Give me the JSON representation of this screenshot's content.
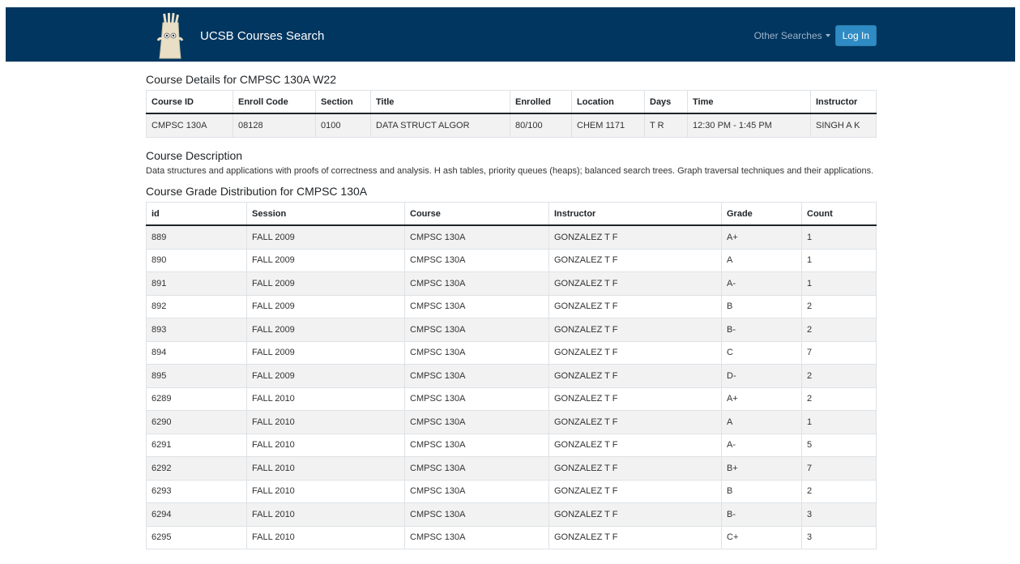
{
  "navbar": {
    "brand": "UCSB Courses Search",
    "other_searches": "Other Searches",
    "login": "Log In"
  },
  "details": {
    "heading": "Course Details for CMPSC 130A W22",
    "headers": [
      "Course ID",
      "Enroll Code",
      "Section",
      "Title",
      "Enrolled",
      "Location",
      "Days",
      "Time",
      "Instructor"
    ],
    "row": [
      "CMPSC 130A",
      "08128",
      "0100",
      "DATA STRUCT ALGOR",
      "80/100",
      "CHEM 1171",
      "T R",
      "12:30 PM - 1:45 PM",
      "SINGH A K"
    ]
  },
  "description": {
    "heading": "Course Description",
    "text": "Data structures and applications with proofs of correctness and analysis. H ash tables, priority queues (heaps); balanced search trees. Graph traversal techniques and their applications."
  },
  "distribution": {
    "heading": "Course Grade Distribution for CMPSC 130A",
    "headers": [
      "id",
      "Session",
      "Course",
      "Instructor",
      "Grade",
      "Count"
    ],
    "rows": [
      [
        "889",
        "FALL 2009",
        "CMPSC 130A",
        "GONZALEZ T F",
        "A+",
        "1"
      ],
      [
        "890",
        "FALL 2009",
        "CMPSC 130A",
        "GONZALEZ T F",
        "A",
        "1"
      ],
      [
        "891",
        "FALL 2009",
        "CMPSC 130A",
        "GONZALEZ T F",
        "A-",
        "1"
      ],
      [
        "892",
        "FALL 2009",
        "CMPSC 130A",
        "GONZALEZ T F",
        "B",
        "2"
      ],
      [
        "893",
        "FALL 2009",
        "CMPSC 130A",
        "GONZALEZ T F",
        "B-",
        "2"
      ],
      [
        "894",
        "FALL 2009",
        "CMPSC 130A",
        "GONZALEZ T F",
        "C",
        "7"
      ],
      [
        "895",
        "FALL 2009",
        "CMPSC 130A",
        "GONZALEZ T F",
        "D-",
        "2"
      ],
      [
        "6289",
        "FALL 2010",
        "CMPSC 130A",
        "GONZALEZ T F",
        "A+",
        "2"
      ],
      [
        "6290",
        "FALL 2010",
        "CMPSC 130A",
        "GONZALEZ T F",
        "A",
        "1"
      ],
      [
        "6291",
        "FALL 2010",
        "CMPSC 130A",
        "GONZALEZ T F",
        "A-",
        "5"
      ],
      [
        "6292",
        "FALL 2010",
        "CMPSC 130A",
        "GONZALEZ T F",
        "B+",
        "7"
      ],
      [
        "6293",
        "FALL 2010",
        "CMPSC 130A",
        "GONZALEZ T F",
        "B",
        "2"
      ],
      [
        "6294",
        "FALL 2010",
        "CMPSC 130A",
        "GONZALEZ T F",
        "B-",
        "3"
      ],
      [
        "6295",
        "FALL 2010",
        "CMPSC 130A",
        "GONZALEZ T F",
        "C+",
        "3"
      ]
    ]
  },
  "colors": {
    "navbar": "#003660",
    "login_button": "#2f8bc3",
    "stripe": "#f2f2f2"
  },
  "icons": {
    "logo": "storke-tower-mascot-icon",
    "dropdown": "caret-down-icon"
  }
}
